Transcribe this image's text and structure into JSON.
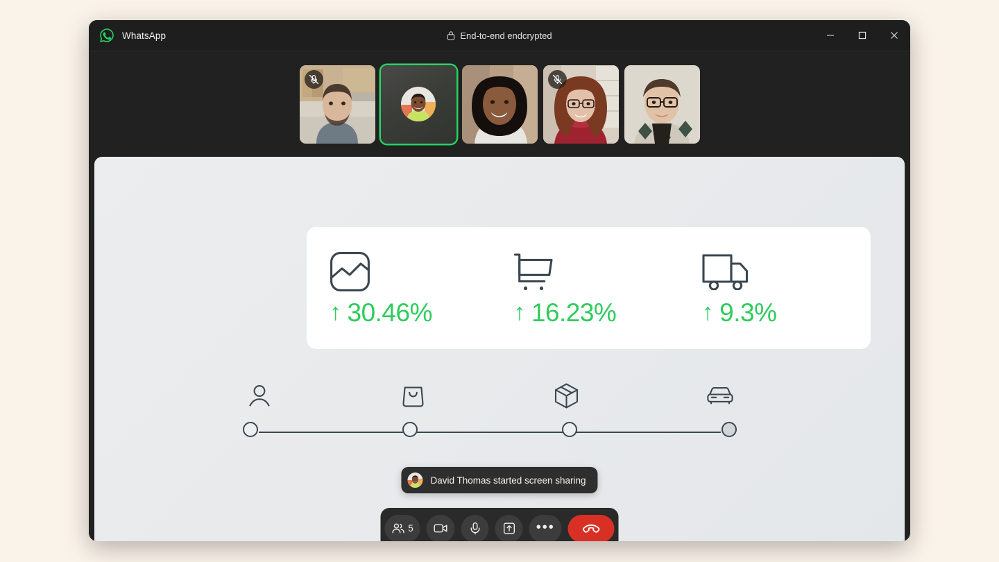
{
  "window": {
    "app_name": "WhatsApp",
    "encryption_label": "End-to-end endcrypted",
    "lock_icon": "lock-icon",
    "logo_icon": "whatsapp-logo-icon",
    "controls": {
      "minimize": "minimize-icon",
      "maximize": "maximize-icon",
      "close": "close-icon"
    }
  },
  "participants": [
    {
      "id": "p1",
      "camera_on": true,
      "muted": true,
      "speaking": false,
      "skin": "#d8b79a",
      "bg": "#c9b294",
      "shirt": "#6e7a84",
      "hair": "#4a3a2e"
    },
    {
      "id": "p2",
      "camera_on": false,
      "muted": false,
      "speaking": true,
      "skin": "#7a4b32",
      "bg": "#e8e6e1",
      "shirt": "#c9e265",
      "hair": "#241a14"
    },
    {
      "id": "p3",
      "camera_on": true,
      "muted": false,
      "speaking": false,
      "skin": "#8a5a3c",
      "bg": "#b99f86",
      "shirt": "#e8e6e3",
      "hair": "#140f0c"
    },
    {
      "id": "p4",
      "camera_on": true,
      "muted": true,
      "speaking": false,
      "skin": "#e3c0a8",
      "bg": "#d9cfc2",
      "shirt": "#9e2230",
      "hair": "#7a3a22"
    },
    {
      "id": "p5",
      "camera_on": true,
      "muted": false,
      "speaking": false,
      "skin": "#e2c2a6",
      "bg": "#ddd8cd",
      "shirt": "#cfc9bd",
      "hair": "#4e3a2a"
    }
  ],
  "shared_screen": {
    "metrics": [
      {
        "icon": "image-chart-icon",
        "arrow": "↑",
        "value": "30.46%"
      },
      {
        "icon": "shopping-cart-icon",
        "arrow": "↑",
        "value": "16.23%"
      },
      {
        "icon": "delivery-truck-icon",
        "arrow": "↑",
        "value": "9.3%"
      }
    ],
    "stepper": [
      {
        "icon": "person-icon",
        "filled": false
      },
      {
        "icon": "shopping-bag-icon",
        "filled": false
      },
      {
        "icon": "package-box-icon",
        "filled": false
      },
      {
        "icon": "car-icon",
        "filled": true
      }
    ]
  },
  "toast": {
    "avatar": "avatar-david-thomas",
    "message": "David Thomas started screen sharing"
  },
  "controls": {
    "participants": {
      "icon": "people-icon",
      "count": "5"
    },
    "camera": {
      "icon": "video-camera-icon"
    },
    "microphone": {
      "icon": "microphone-icon"
    },
    "share_screen": {
      "icon": "share-screen-icon"
    },
    "more": {
      "icon": "more-options-icon",
      "glyph": "•••"
    },
    "end_call": {
      "icon": "end-call-icon"
    }
  },
  "colors": {
    "brand_green": "#25d366",
    "metric_green": "#2ecc5c",
    "end_call_red": "#d93025",
    "page_background": "#faf3ea",
    "window_background": "#212121",
    "stage_background": "#eceef0",
    "icon_slate": "#3a4750"
  }
}
